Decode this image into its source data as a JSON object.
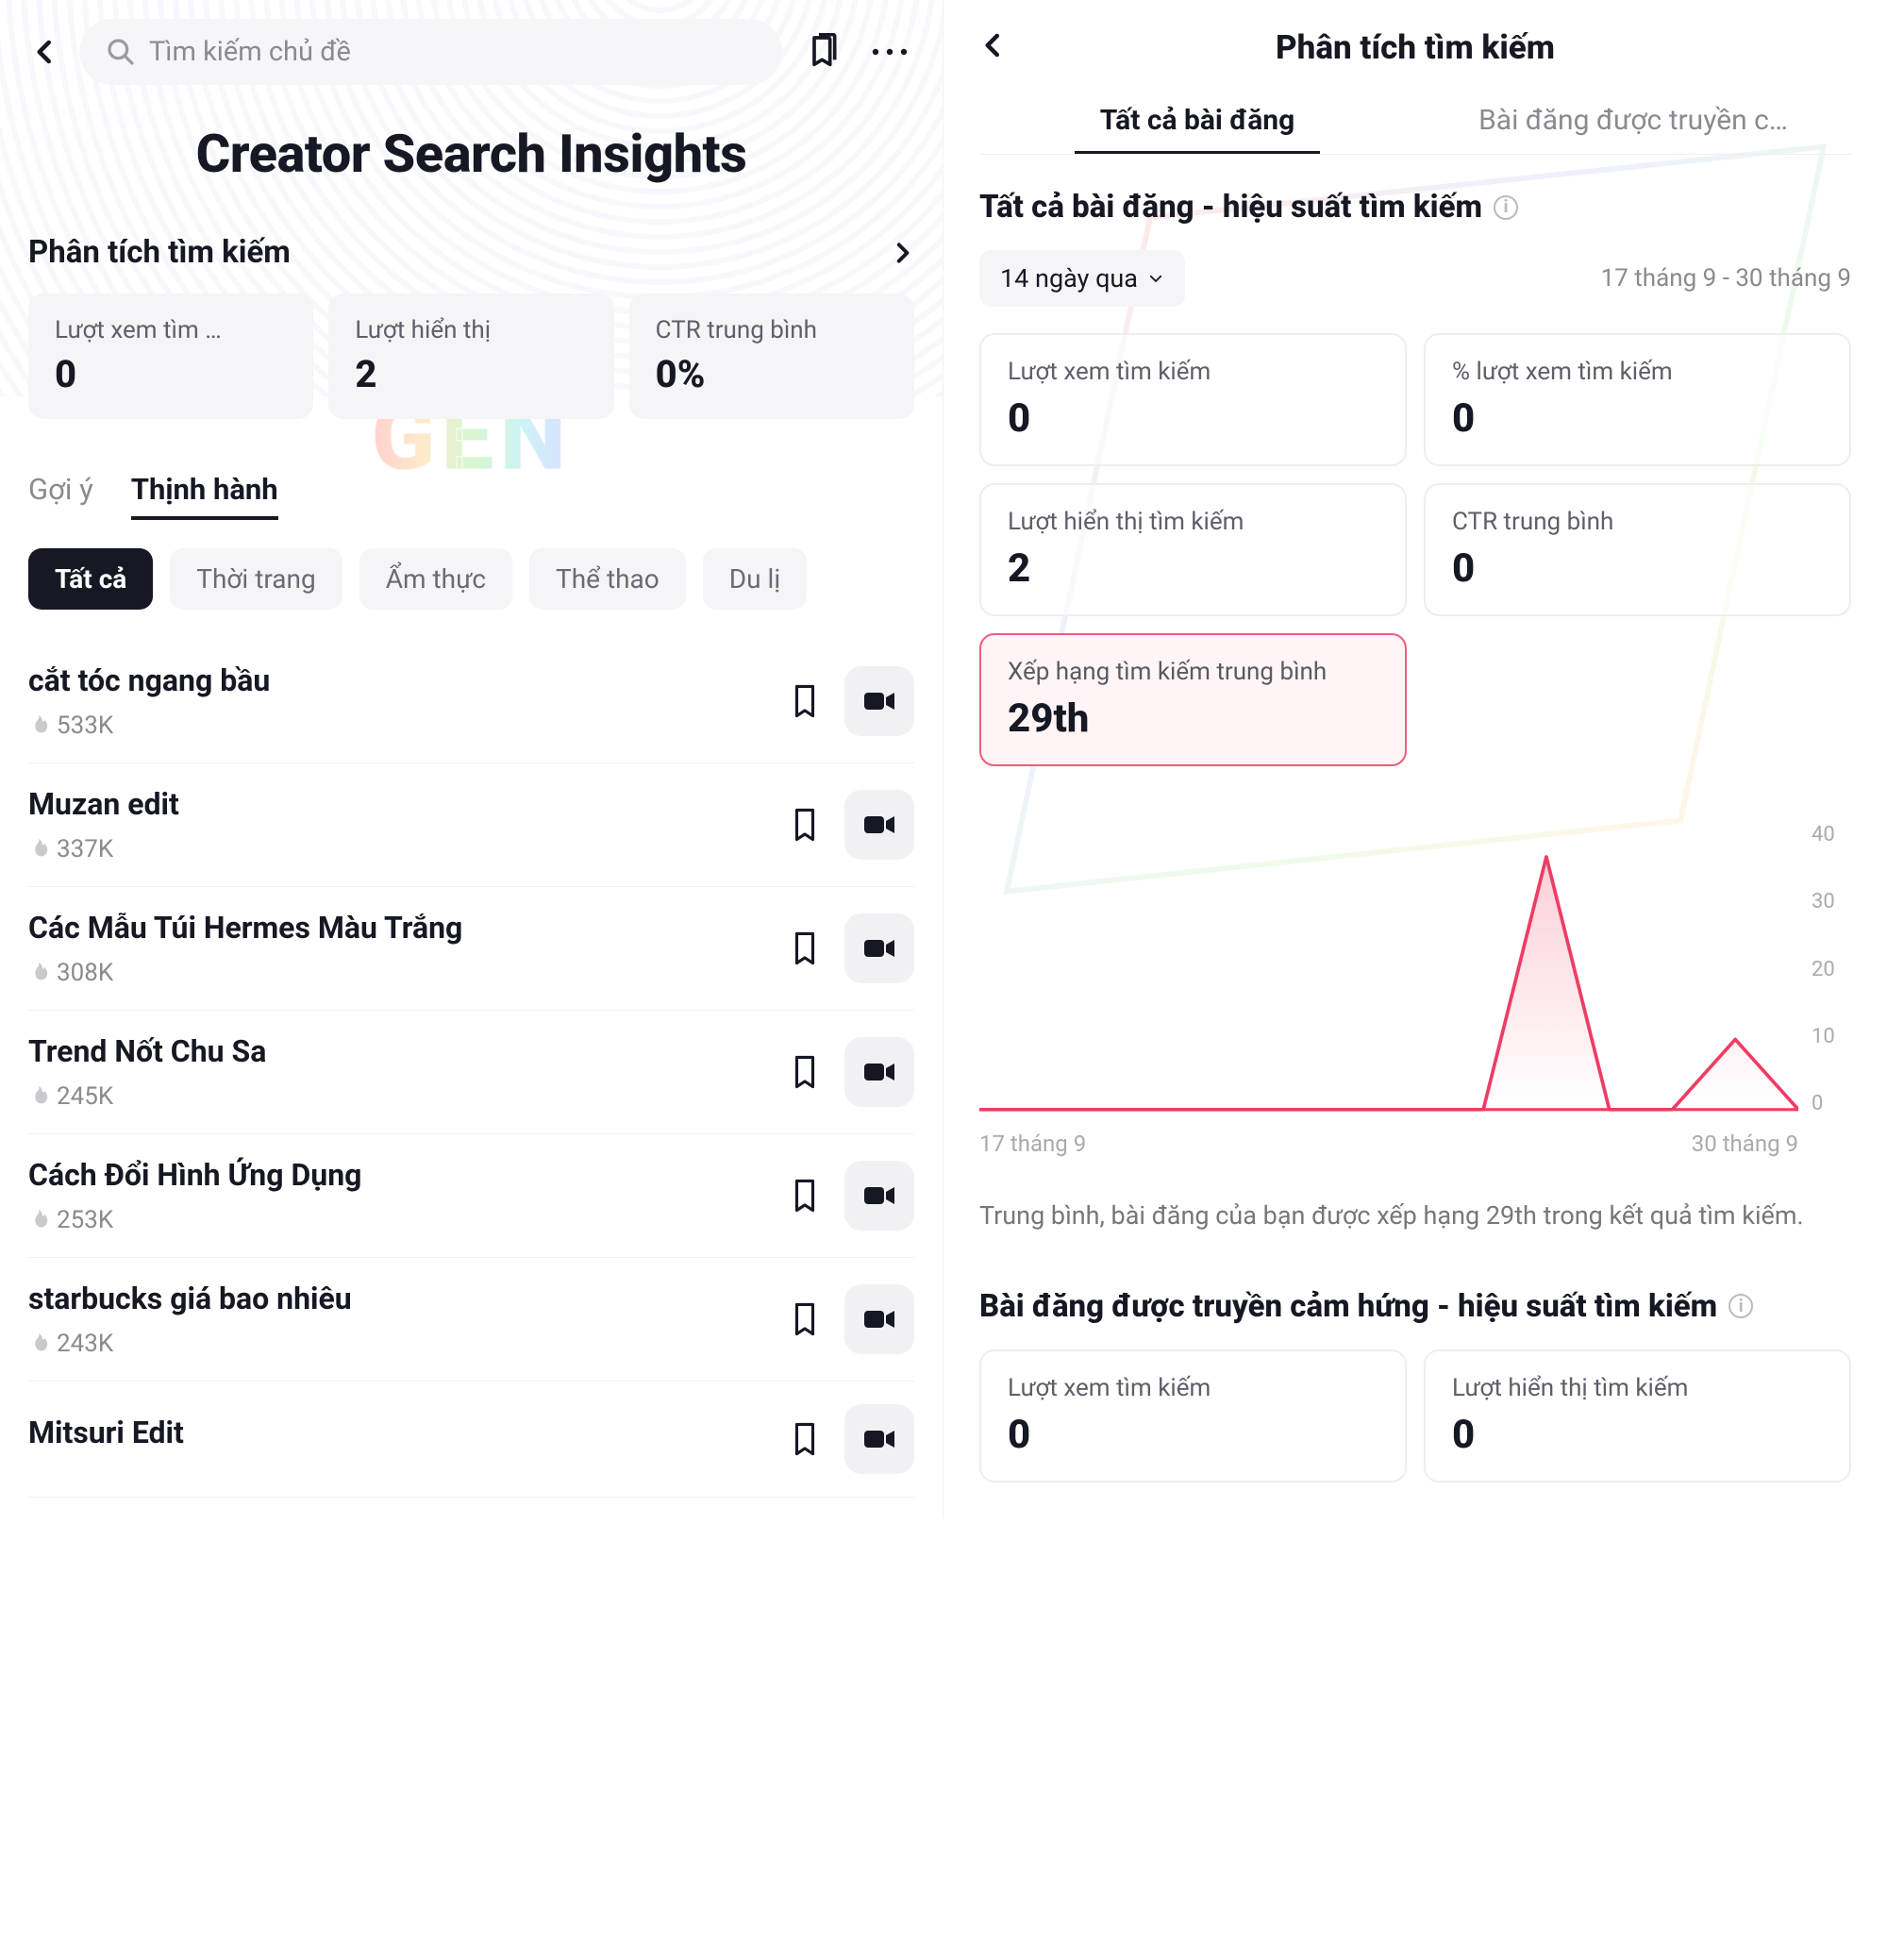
{
  "left": {
    "search_placeholder": "Tìm kiếm chủ đề",
    "page_title": "Creator Search Insights",
    "analytics_section_label": "Phân tích tìm kiếm",
    "stats": [
      {
        "label": "Lượt xem tìm …",
        "value": "0"
      },
      {
        "label": "Lượt hiển thị",
        "value": "2"
      },
      {
        "label": "CTR trung bình",
        "value": "0%"
      }
    ],
    "tabs": [
      {
        "label": "Gợi ý",
        "active": false
      },
      {
        "label": "Thịnh hành",
        "active": true
      }
    ],
    "chips": [
      {
        "label": "Tất cả",
        "active": true
      },
      {
        "label": "Thời trang",
        "active": false
      },
      {
        "label": "Ẩm thực",
        "active": false
      },
      {
        "label": "Thể thao",
        "active": false
      },
      {
        "label": "Du lị",
        "active": false
      }
    ],
    "topics": [
      {
        "title": "cắt tóc ngang bầu",
        "count": "533K"
      },
      {
        "title": "Muzan edit",
        "count": "337K"
      },
      {
        "title": "Các Mẫu Túi Hermes Màu Trắng",
        "count": "308K"
      },
      {
        "title": "Trend Nốt Chu Sa",
        "count": "245K"
      },
      {
        "title": "Cách Đổi Hình Ứng Dụng",
        "count": "253K"
      },
      {
        "title": "starbucks giá bao nhiêu",
        "count": "243K"
      },
      {
        "title": "Mitsuri Edit",
        "count": ""
      }
    ],
    "watermark": "GEN"
  },
  "right": {
    "title": "Phân tích tìm kiếm",
    "tabs": [
      {
        "label": "Tất cả bài đăng",
        "active": true
      },
      {
        "label": "Bài đăng được truyền c…",
        "active": false
      }
    ],
    "section1_title": "Tất cả bài đăng - hiệu suất tìm kiếm",
    "date_filter_label": "14 ngày qua",
    "date_range_text": "17 tháng 9 - 30 tháng 9",
    "metrics": [
      {
        "label": "Lượt xem tìm kiếm",
        "value": "0"
      },
      {
        "label": "% lượt xem tìm kiếm",
        "value": "0"
      },
      {
        "label": "Lượt hiển thị tìm kiếm",
        "value": "2"
      },
      {
        "label": "CTR trung bình",
        "value": "0"
      }
    ],
    "highlight_metric": {
      "label": "Xếp hạng tìm kiếm trung bình",
      "value": "29th"
    },
    "chart_x_start": "17 tháng 9",
    "chart_x_end": "30 tháng 9",
    "chart_note": "Trung bình, bài đăng của bạn được xếp hạng 29th trong kết quả tìm kiếm.",
    "section2_title": "Bài đăng được truyền cảm hứng - hiệu suất tìm kiếm",
    "metrics2": [
      {
        "label": "Lượt xem tìm kiếm",
        "value": "0"
      },
      {
        "label": "Lượt hiển thị tìm kiếm",
        "value": "0"
      }
    ]
  },
  "chart_data": {
    "type": "line",
    "title": "",
    "xlabel": "",
    "ylabel": "",
    "ylim": [
      0,
      40
    ],
    "y_ticks": [
      40,
      30,
      20,
      10,
      0
    ],
    "x_start_label": "17 tháng 9",
    "x_end_label": "30 tháng 9",
    "x": [
      0,
      1,
      2,
      3,
      4,
      5,
      6,
      7,
      8,
      9,
      10,
      11,
      12,
      13
    ],
    "values": [
      0,
      0,
      0,
      0,
      0,
      0,
      0,
      0,
      0,
      36,
      0,
      0,
      10,
      0
    ],
    "color": "#ef3c64"
  }
}
